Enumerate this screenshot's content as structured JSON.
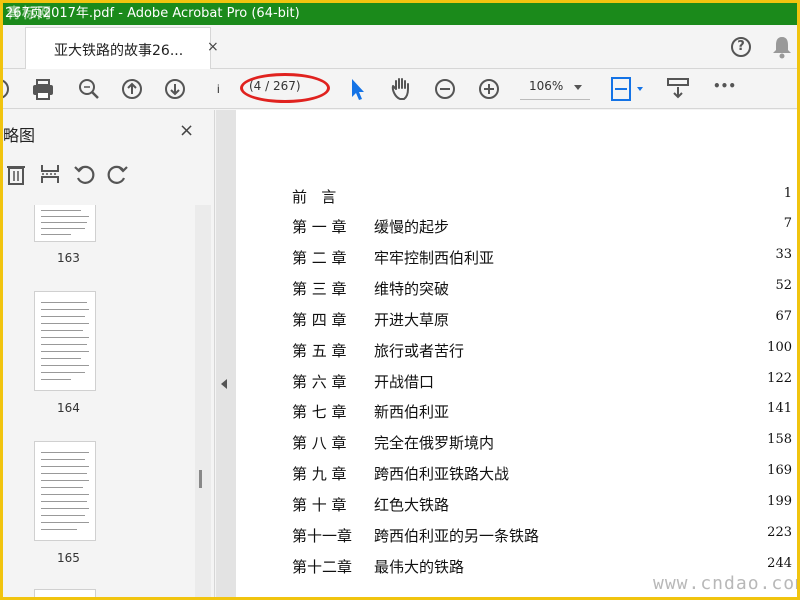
{
  "window": {
    "title": "267页2017年.pdf - Adobe Acrobat Pro (64-bit)",
    "watermark_logo": "青标网"
  },
  "tab": {
    "title": "亚大铁路的故事26...",
    "close": "×"
  },
  "header": {
    "help": "?"
  },
  "toolbar": {
    "page_input_value": "i",
    "page_count": "(4 / 267)",
    "zoom": "106%",
    "more": "•••"
  },
  "sidebar": {
    "title": "略图",
    "close": "×",
    "thumbnails": [
      {
        "label": "163"
      },
      {
        "label": "164"
      },
      {
        "label": "165"
      }
    ]
  },
  "toc": [
    {
      "chapter": "前   言",
      "title": "",
      "page": "1"
    },
    {
      "chapter": "第 一 章",
      "title": "缓慢的起步",
      "page": "7"
    },
    {
      "chapter": "第 二 章",
      "title": "牢牢控制西伯利亚",
      "page": "33"
    },
    {
      "chapter": "第 三 章",
      "title": "维特的突破",
      "page": "52"
    },
    {
      "chapter": "第 四 章",
      "title": "开进大草原",
      "page": "67"
    },
    {
      "chapter": "第 五 章",
      "title": "旅行或者苦行",
      "page": "100"
    },
    {
      "chapter": "第 六 章",
      "title": "开战借口",
      "page": "122"
    },
    {
      "chapter": "第 七 章",
      "title": "新西伯利亚",
      "page": "141"
    },
    {
      "chapter": "第 八 章",
      "title": "完全在俄罗斯境内",
      "page": "158"
    },
    {
      "chapter": "第 九 章",
      "title": "跨西伯利亚铁路大战",
      "page": "169"
    },
    {
      "chapter": "第 十 章",
      "title": "红色大铁路",
      "page": "199"
    },
    {
      "chapter": "第十一章",
      "title": "跨西伯利亚的另一条铁路",
      "page": "223"
    },
    {
      "chapter": "第十二章",
      "title": "最伟大的铁路",
      "page": "244"
    }
  ],
  "site_watermark": "www.cndao.com",
  "colors": {
    "titlebar": "#1b8a1b",
    "accent_blue": "#1473e6",
    "highlight_red": "#e0221f",
    "frame_yellow": "#f1c40f"
  }
}
